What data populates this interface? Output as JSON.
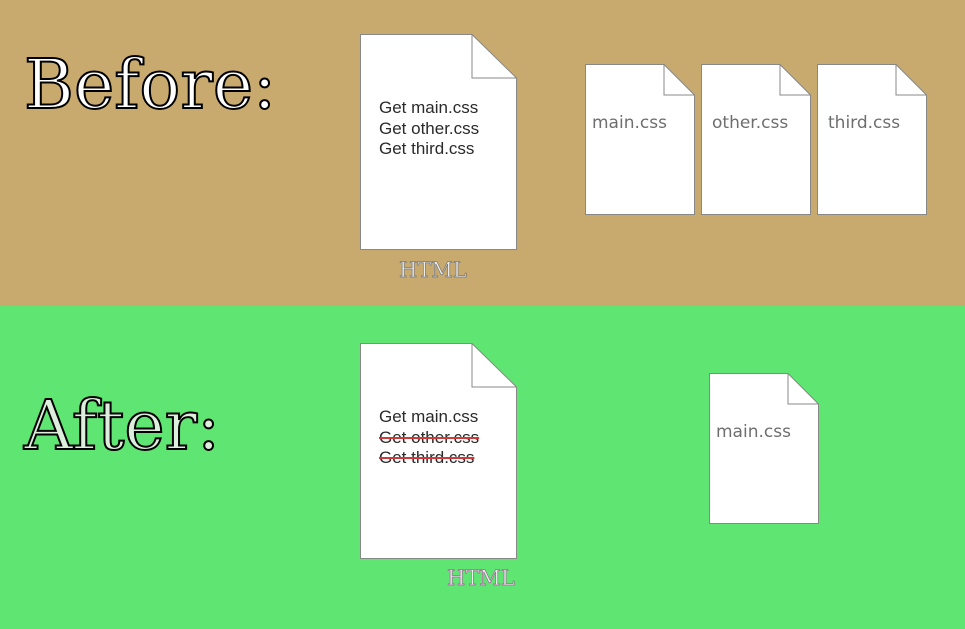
{
  "before": {
    "heading": "Before:",
    "html_doc": {
      "lines": [
        "Get main.css",
        "Get other.css",
        "Get third.css"
      ],
      "caption": "HTML"
    },
    "css_files": [
      "main.css",
      "other.css",
      "third.css"
    ],
    "background_color": "#c8aa6e"
  },
  "after": {
    "heading": "After:",
    "html_doc": {
      "lines": [
        "Get main.css",
        "Get other.css",
        "Get third.css"
      ],
      "struck_lines": [
        false,
        true,
        true
      ],
      "caption": "HTML"
    },
    "css_files": [
      "main.css"
    ],
    "background_color": "#5fe672",
    "strike_color": "#d23a3a"
  }
}
